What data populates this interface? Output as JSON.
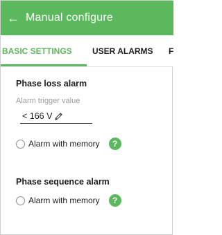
{
  "colors": {
    "accent": "#5cb85c",
    "text": "#202020",
    "muted": "#9a9a9a"
  },
  "header": {
    "back_icon": "arrow-left-icon",
    "back_glyph": "←",
    "title": "Manual configure"
  },
  "tabs": [
    {
      "label": "BASIC SETTINGS",
      "active": true
    },
    {
      "label": "USER ALARMS",
      "active": false
    },
    {
      "label": "F",
      "active": false
    }
  ],
  "phase_loss": {
    "title": "Phase loss alarm",
    "trigger_label": "Alarm trigger value",
    "trigger_value": "< 166 V",
    "edit_icon": "pencil-icon",
    "memory_label": "Alarm with memory",
    "memory_checked": false,
    "help_glyph": "?"
  },
  "phase_sequence": {
    "title": "Phase sequence alarm",
    "memory_label": "Alarm with memory",
    "memory_checked": false,
    "help_glyph": "?"
  }
}
